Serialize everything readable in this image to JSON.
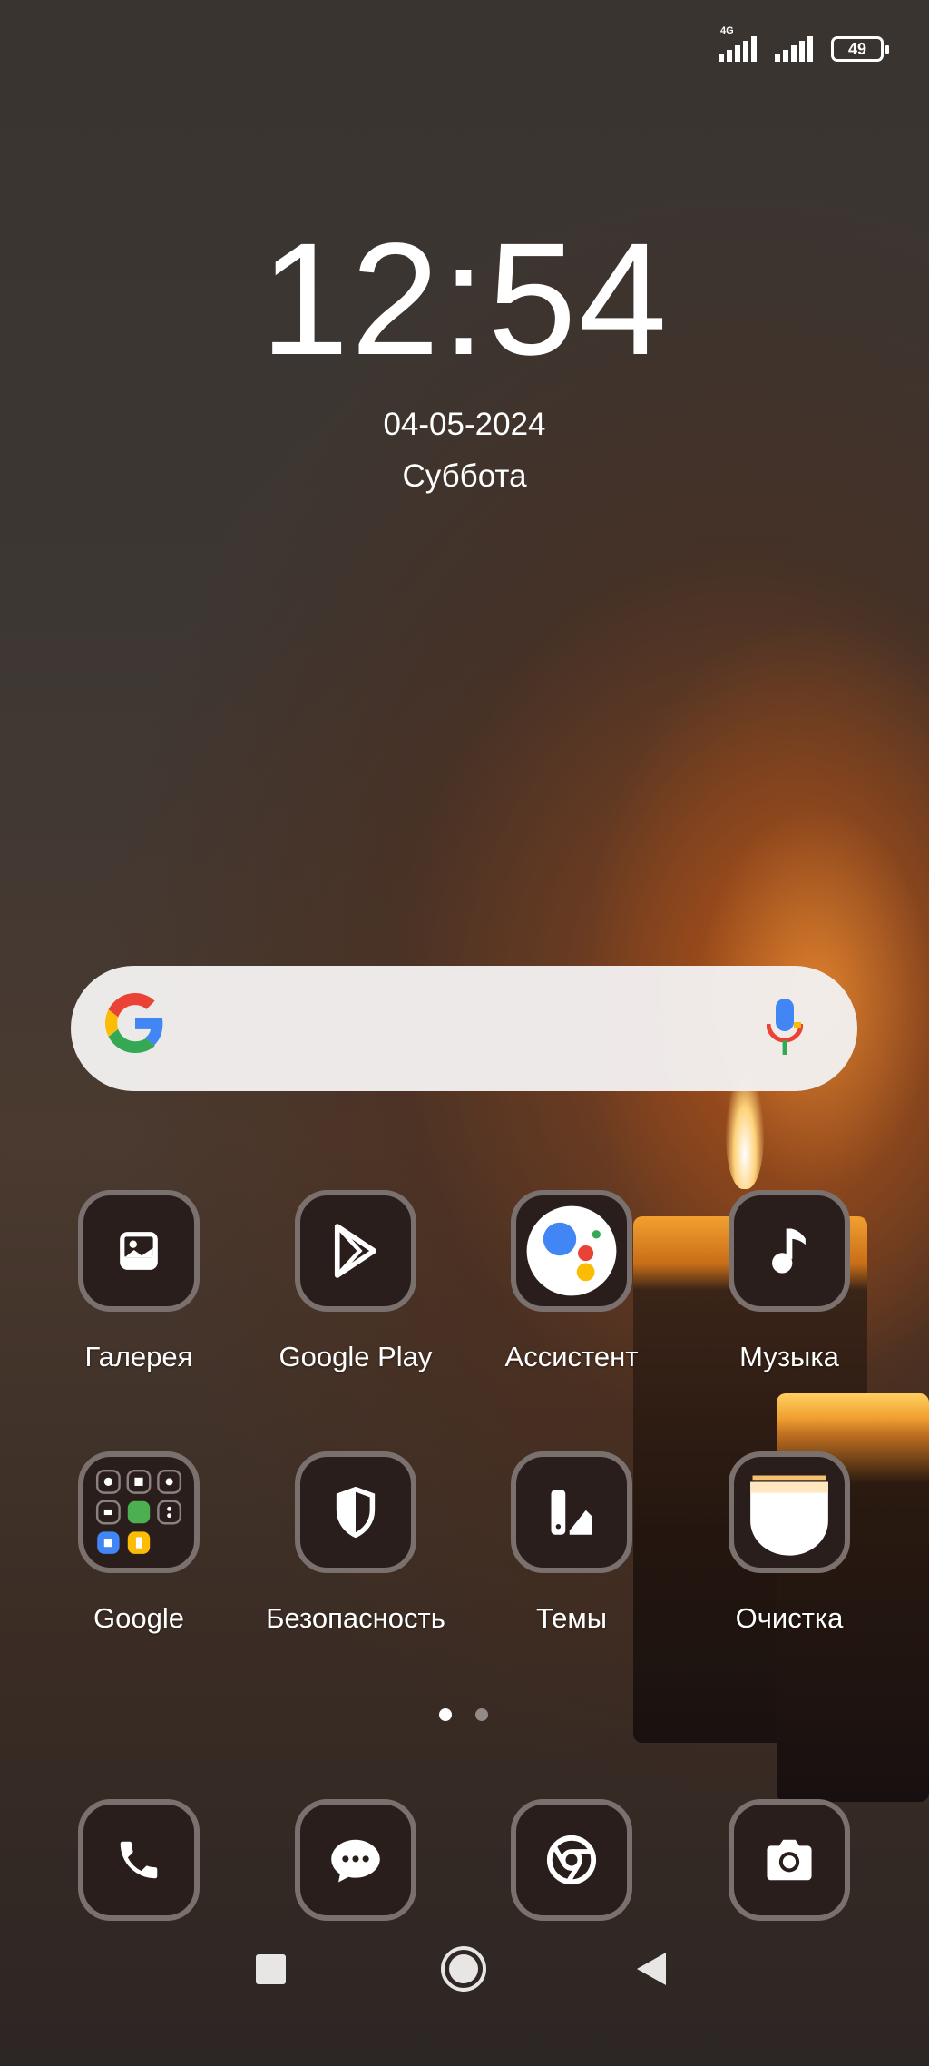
{
  "status_bar": {
    "network": "4G",
    "battery": "49"
  },
  "clock": {
    "time": "12:54",
    "date": "04-05-2024",
    "weekday": "Суббота"
  },
  "search": {
    "logo": "G",
    "logo_colors": [
      "#4285F4",
      "#EA4335",
      "#FBBC05",
      "#34A853"
    ]
  },
  "apps": [
    {
      "label": "Галерея",
      "icon": "gallery-icon"
    },
    {
      "label": "Google Play",
      "icon": "play-store-icon"
    },
    {
      "label": "Ассистент",
      "icon": "assistant-icon"
    },
    {
      "label": "Музыка",
      "icon": "music-note-icon"
    },
    {
      "label": "Google",
      "icon": "folder-icon"
    },
    {
      "label": "Безопасность",
      "icon": "shield-icon"
    },
    {
      "label": "Темы",
      "icon": "themes-icon"
    },
    {
      "label": "Очистка",
      "icon": "cleaner-icon"
    }
  ],
  "page_indicator": {
    "pages": 2,
    "current": 1
  },
  "dock": [
    {
      "icon": "phone-icon"
    },
    {
      "icon": "messages-icon"
    },
    {
      "icon": "chrome-icon"
    },
    {
      "icon": "camera-icon"
    }
  ],
  "nav": [
    "recents-icon",
    "home-icon",
    "back-icon"
  ]
}
